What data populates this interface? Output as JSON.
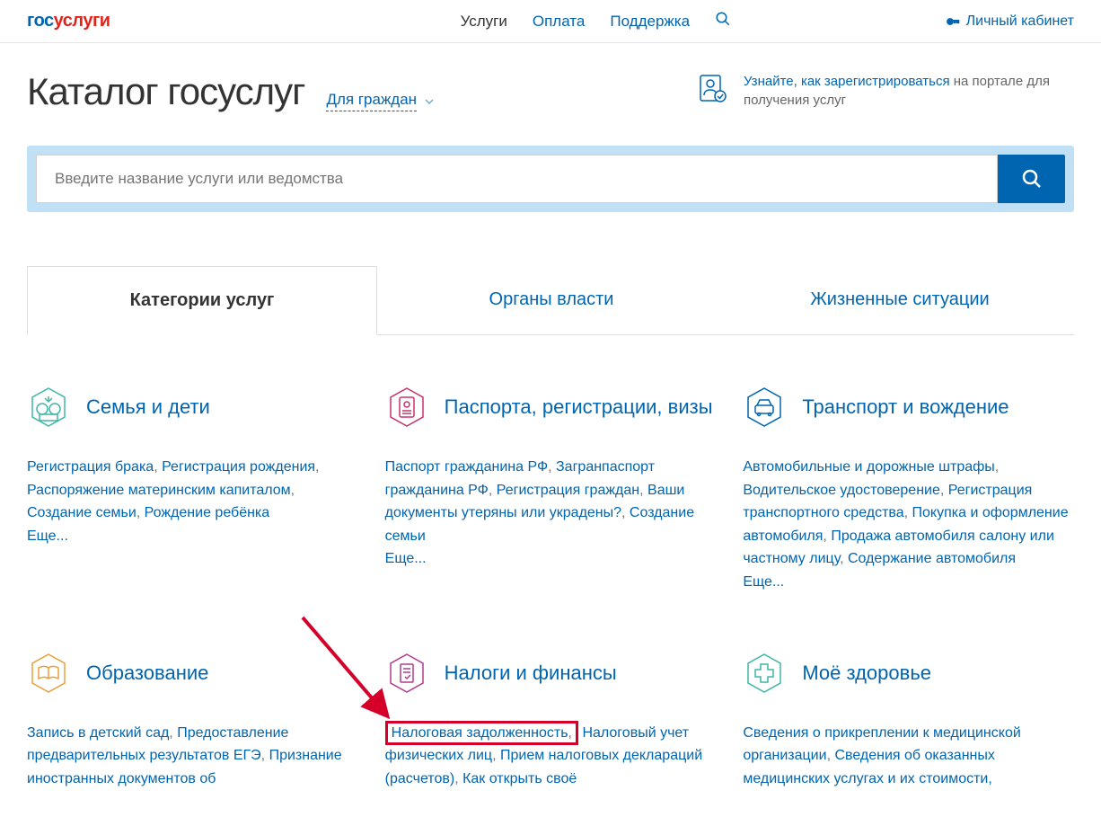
{
  "logo": {
    "part1": "гос",
    "part2": "услуги"
  },
  "nav": {
    "services": "Услуги",
    "payment": "Оплата",
    "support": "Поддержка",
    "cabinet": "Личный кабинет"
  },
  "page": {
    "title": "Каталог госуслуг",
    "filter": "Для граждан",
    "register_link": "Узнайте, как зарегистрироваться",
    "register_rest": " на портале для получения услуг"
  },
  "search": {
    "placeholder": "Введите название услуги или ведомства"
  },
  "tabs": {
    "categories": "Категории услуг",
    "authorities": "Органы власти",
    "life": "Жизненные ситуации"
  },
  "categories": {
    "family": {
      "title": "Семья и дети",
      "items": [
        "Регистрация брака",
        "Регистрация рождения",
        "Распоряжение материнским капиталом",
        "Создание семьи",
        "Рождение ребёнка"
      ],
      "more": "Еще..."
    },
    "passport": {
      "title": "Паспорта, регистрации, визы",
      "items": [
        "Паспорт гражданина РФ",
        "Загранпаспорт гражданина РФ",
        "Регистрация граждан",
        "Ваши документы утеряны или украдены?",
        "Создание семьи"
      ],
      "more": "Еще..."
    },
    "transport": {
      "title": "Транспорт и вождение",
      "items": [
        "Автомобильные и дорожные штрафы",
        "Водительское удостоверение",
        "Регистрация транспортного средства",
        "Покупка и оформление автомобиля",
        "Продажа автомобиля салону или частному лицу",
        "Содержание автомобиля"
      ],
      "more": "Еще..."
    },
    "education": {
      "title": "Образование",
      "items": [
        "Запись в детский сад",
        "Предоставление предварительных результатов ЕГЭ",
        "Признание иностранных документов об"
      ]
    },
    "tax": {
      "title": "Налоги и финансы",
      "highlight": "Налоговая задолженность",
      "items_rest": [
        "Налоговый учет физических лиц",
        "Прием налоговых деклараций (расчетов)",
        "Как открыть своё"
      ]
    },
    "health": {
      "title": "Моё здоровье",
      "items": [
        "Сведения о прикреплении к медицинской организации",
        "Сведения об оказанных медицинских услугах и их стоимости,"
      ]
    }
  }
}
